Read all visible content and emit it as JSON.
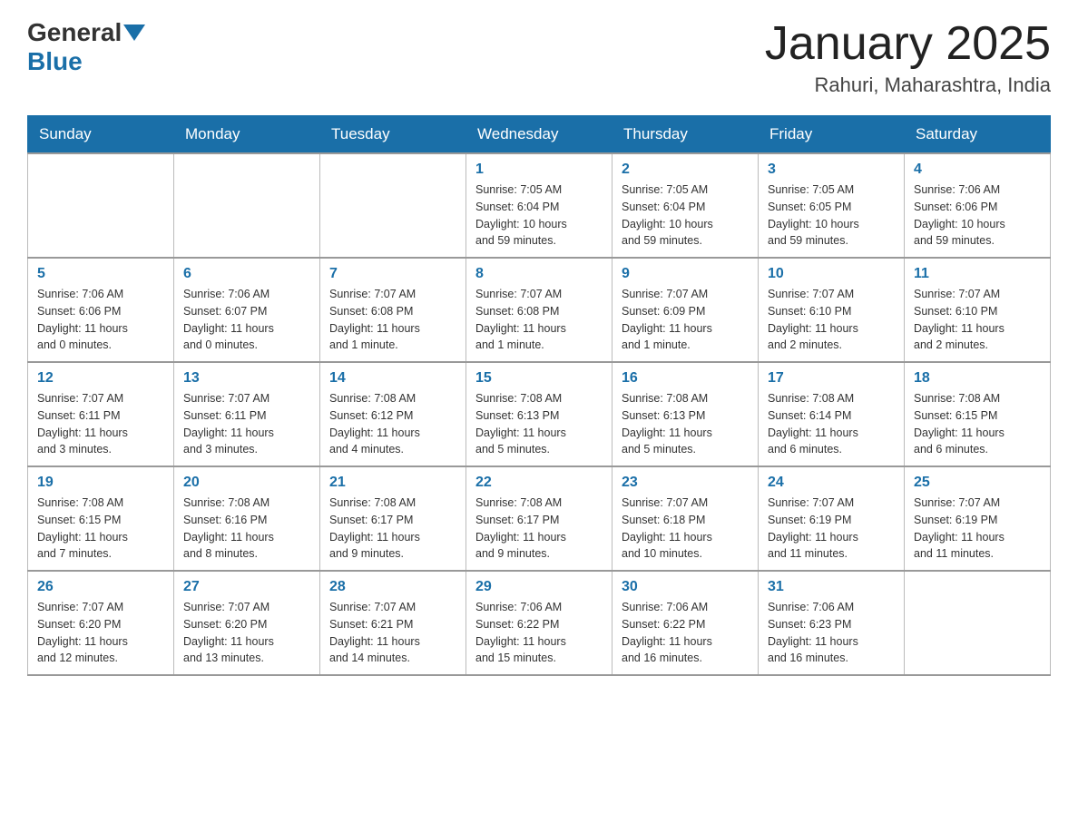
{
  "header": {
    "logo_general": "General",
    "logo_blue": "Blue",
    "month_title": "January 2025",
    "location": "Rahuri, Maharashtra, India"
  },
  "days_of_week": [
    "Sunday",
    "Monday",
    "Tuesday",
    "Wednesday",
    "Thursday",
    "Friday",
    "Saturday"
  ],
  "weeks": [
    [
      {
        "day": "",
        "info": ""
      },
      {
        "day": "",
        "info": ""
      },
      {
        "day": "",
        "info": ""
      },
      {
        "day": "1",
        "info": "Sunrise: 7:05 AM\nSunset: 6:04 PM\nDaylight: 10 hours\nand 59 minutes."
      },
      {
        "day": "2",
        "info": "Sunrise: 7:05 AM\nSunset: 6:04 PM\nDaylight: 10 hours\nand 59 minutes."
      },
      {
        "day": "3",
        "info": "Sunrise: 7:05 AM\nSunset: 6:05 PM\nDaylight: 10 hours\nand 59 minutes."
      },
      {
        "day": "4",
        "info": "Sunrise: 7:06 AM\nSunset: 6:06 PM\nDaylight: 10 hours\nand 59 minutes."
      }
    ],
    [
      {
        "day": "5",
        "info": "Sunrise: 7:06 AM\nSunset: 6:06 PM\nDaylight: 11 hours\nand 0 minutes."
      },
      {
        "day": "6",
        "info": "Sunrise: 7:06 AM\nSunset: 6:07 PM\nDaylight: 11 hours\nand 0 minutes."
      },
      {
        "day": "7",
        "info": "Sunrise: 7:07 AM\nSunset: 6:08 PM\nDaylight: 11 hours\nand 1 minute."
      },
      {
        "day": "8",
        "info": "Sunrise: 7:07 AM\nSunset: 6:08 PM\nDaylight: 11 hours\nand 1 minute."
      },
      {
        "day": "9",
        "info": "Sunrise: 7:07 AM\nSunset: 6:09 PM\nDaylight: 11 hours\nand 1 minute."
      },
      {
        "day": "10",
        "info": "Sunrise: 7:07 AM\nSunset: 6:10 PM\nDaylight: 11 hours\nand 2 minutes."
      },
      {
        "day": "11",
        "info": "Sunrise: 7:07 AM\nSunset: 6:10 PM\nDaylight: 11 hours\nand 2 minutes."
      }
    ],
    [
      {
        "day": "12",
        "info": "Sunrise: 7:07 AM\nSunset: 6:11 PM\nDaylight: 11 hours\nand 3 minutes."
      },
      {
        "day": "13",
        "info": "Sunrise: 7:07 AM\nSunset: 6:11 PM\nDaylight: 11 hours\nand 3 minutes."
      },
      {
        "day": "14",
        "info": "Sunrise: 7:08 AM\nSunset: 6:12 PM\nDaylight: 11 hours\nand 4 minutes."
      },
      {
        "day": "15",
        "info": "Sunrise: 7:08 AM\nSunset: 6:13 PM\nDaylight: 11 hours\nand 5 minutes."
      },
      {
        "day": "16",
        "info": "Sunrise: 7:08 AM\nSunset: 6:13 PM\nDaylight: 11 hours\nand 5 minutes."
      },
      {
        "day": "17",
        "info": "Sunrise: 7:08 AM\nSunset: 6:14 PM\nDaylight: 11 hours\nand 6 minutes."
      },
      {
        "day": "18",
        "info": "Sunrise: 7:08 AM\nSunset: 6:15 PM\nDaylight: 11 hours\nand 6 minutes."
      }
    ],
    [
      {
        "day": "19",
        "info": "Sunrise: 7:08 AM\nSunset: 6:15 PM\nDaylight: 11 hours\nand 7 minutes."
      },
      {
        "day": "20",
        "info": "Sunrise: 7:08 AM\nSunset: 6:16 PM\nDaylight: 11 hours\nand 8 minutes."
      },
      {
        "day": "21",
        "info": "Sunrise: 7:08 AM\nSunset: 6:17 PM\nDaylight: 11 hours\nand 9 minutes."
      },
      {
        "day": "22",
        "info": "Sunrise: 7:08 AM\nSunset: 6:17 PM\nDaylight: 11 hours\nand 9 minutes."
      },
      {
        "day": "23",
        "info": "Sunrise: 7:07 AM\nSunset: 6:18 PM\nDaylight: 11 hours\nand 10 minutes."
      },
      {
        "day": "24",
        "info": "Sunrise: 7:07 AM\nSunset: 6:19 PM\nDaylight: 11 hours\nand 11 minutes."
      },
      {
        "day": "25",
        "info": "Sunrise: 7:07 AM\nSunset: 6:19 PM\nDaylight: 11 hours\nand 11 minutes."
      }
    ],
    [
      {
        "day": "26",
        "info": "Sunrise: 7:07 AM\nSunset: 6:20 PM\nDaylight: 11 hours\nand 12 minutes."
      },
      {
        "day": "27",
        "info": "Sunrise: 7:07 AM\nSunset: 6:20 PM\nDaylight: 11 hours\nand 13 minutes."
      },
      {
        "day": "28",
        "info": "Sunrise: 7:07 AM\nSunset: 6:21 PM\nDaylight: 11 hours\nand 14 minutes."
      },
      {
        "day": "29",
        "info": "Sunrise: 7:06 AM\nSunset: 6:22 PM\nDaylight: 11 hours\nand 15 minutes."
      },
      {
        "day": "30",
        "info": "Sunrise: 7:06 AM\nSunset: 6:22 PM\nDaylight: 11 hours\nand 16 minutes."
      },
      {
        "day": "31",
        "info": "Sunrise: 7:06 AM\nSunset: 6:23 PM\nDaylight: 11 hours\nand 16 minutes."
      },
      {
        "day": "",
        "info": ""
      }
    ]
  ]
}
